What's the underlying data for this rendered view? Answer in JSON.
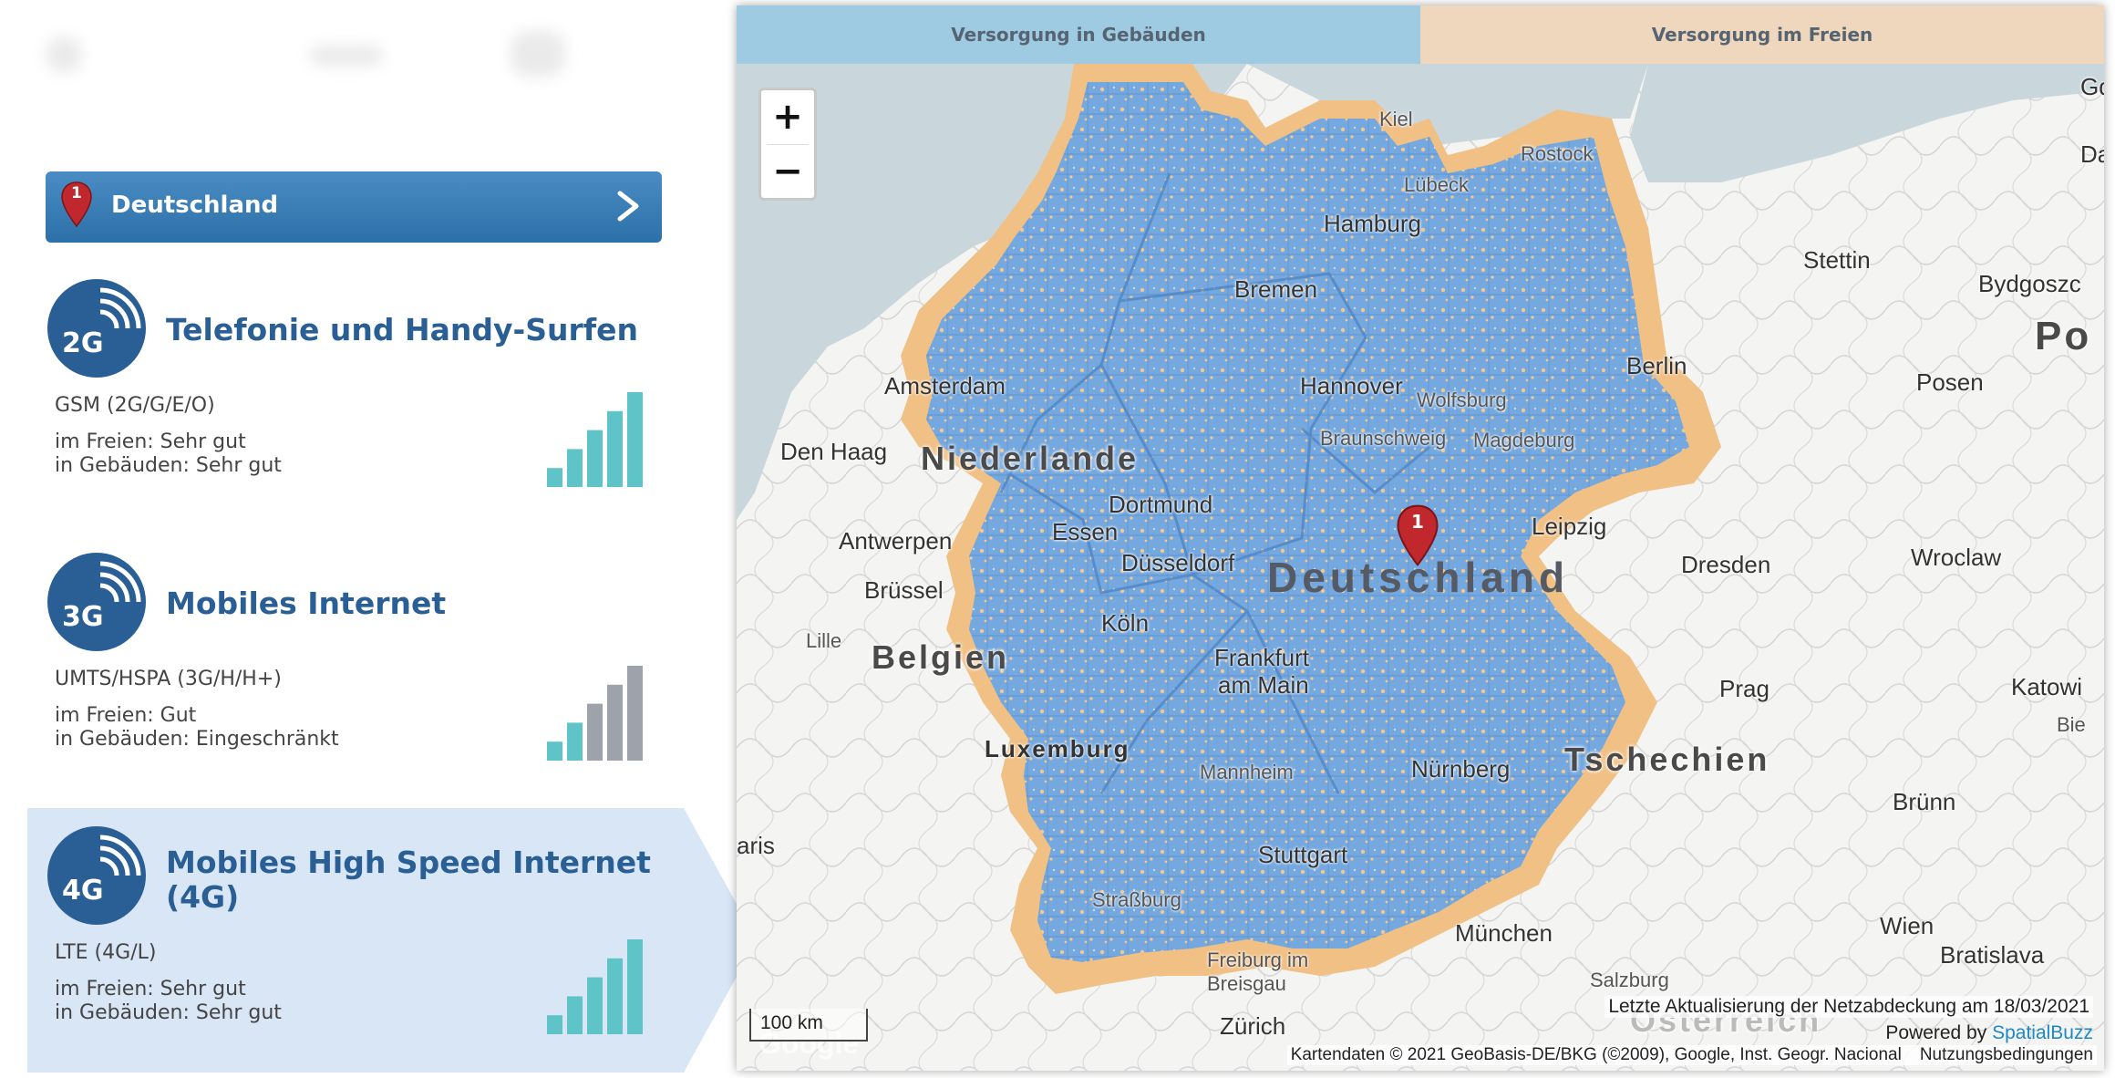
{
  "location": {
    "label": "Deutschland",
    "pin_number": "1"
  },
  "technologies": [
    {
      "badge": "2G",
      "title": "Telefonie und Handy-Surfen",
      "standard": "GSM (2G/G/E/O)",
      "outdoor": "im Freien: Sehr gut",
      "indoor": "in Gebäuden: Sehr gut",
      "signal_level": 5,
      "signal_max": 5
    },
    {
      "badge": "3G",
      "title": "Mobiles Internet",
      "standard": "UMTS/HSPA (3G/H/H+)",
      "outdoor": "im Freien: Gut",
      "indoor": "in Gebäuden: Eingeschränkt",
      "signal_level": 2,
      "signal_max": 5
    },
    {
      "badge": "4G",
      "title_line1": "Mobiles High Speed Internet",
      "title_line2": "(4G)",
      "standard": "LTE (4G/L)",
      "outdoor": "im Freien: Sehr gut",
      "indoor": "in Gebäuden: Sehr gut",
      "signal_level": 5,
      "signal_max": 5,
      "selected": true
    }
  ],
  "map": {
    "tabs": {
      "indoor": "Versorgung in Gebäuden",
      "outdoor": "Versorgung im Freien"
    },
    "zoom_in": "+",
    "zoom_out": "−",
    "marker_number": "1",
    "cities": {
      "kiel": "Kiel",
      "rostock": "Rostock",
      "luebeck": "Lübeck",
      "hamburg": "Hamburg",
      "stettin": "Stettin",
      "gdynia": "Gdy",
      "danzig": "Dar",
      "bremen": "Bremen",
      "bydgoszcz": "Bydgoszc",
      "amsterdam": "Amsterdam",
      "hannover": "Hannover",
      "wolfsburg": "Wolfsburg",
      "berlin": "Berlin",
      "posen": "Posen",
      "denhaag": "Den Haag",
      "braunschweig": "Braunschweig",
      "magdeburg": "Magdeburg",
      "dortmund": "Dortmund",
      "essen": "Essen",
      "duesseldorf": "Düsseldorf",
      "leipzig": "Leipzig",
      "antwerpen": "Antwerpen",
      "dresden": "Dresden",
      "wroclaw": "Wroclaw",
      "bruessel": "Brüssel",
      "koeln": "Köln",
      "lille": "Lille",
      "frankfurt1": "Frankfurt",
      "frankfurt2": "am Main",
      "prag": "Prag",
      "katowice": "Katowi",
      "bie": "Bie",
      "luxemburg": "Luxemburg",
      "mannheim": "Mannheim",
      "nuernberg": "Nürnberg",
      "bruenn": "Brünn",
      "paris": "aris",
      "stuttgart": "Stuttgart",
      "strassburg": "Straßburg",
      "muenchen": "München",
      "wien": "Wien",
      "bratislava": "Bratislava",
      "freiburg1": "Freiburg im",
      "freiburg2": "Breisgau",
      "salzburg": "Salzburg",
      "zuerich": "Zürich"
    },
    "countries": {
      "niederlande": "Niederlande",
      "belgien": "Belgien",
      "deutschland": "Deutschland",
      "tschechien": "Tschechien",
      "polen": "Po",
      "oesterreich": "Österreich"
    },
    "scale": "100 km",
    "update_note": "Letzte Aktualisierung der Netzabdeckung am 18/03/2021",
    "powered_by": "Powered by",
    "powered_link": "SpatialBuzz",
    "copyright": "Kartendaten © 2021 GeoBasis-DE/BKG (©2009), Google, Inst. Geogr. Nacional",
    "terms": "Nutzungsbedingungen",
    "watermark": "Google"
  },
  "colors": {
    "bar_active": "#5ec4c8",
    "bar_inactive": "#9ea3ab",
    "badge_bg": "#2a5f95",
    "coverage_indoor": "#6fa6de",
    "coverage_outdoor": "#f0c085",
    "marker": "#c0282d"
  }
}
